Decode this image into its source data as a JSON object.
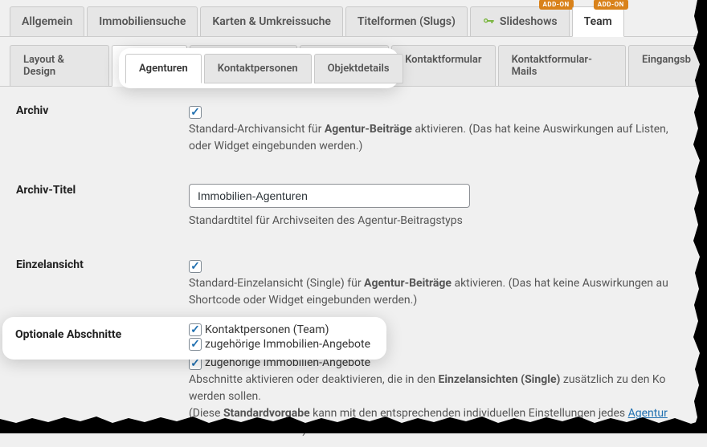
{
  "colors": {
    "accent": "#2271b1",
    "badge": "#d9821b"
  },
  "tabs_top": [
    {
      "label": "Allgemein",
      "active": false
    },
    {
      "label": "Immobiliensuche",
      "active": false
    },
    {
      "label": "Karten & Umkreissuche",
      "active": false
    },
    {
      "label": "Titelformen (Slugs)",
      "active": false
    },
    {
      "label": "Slideshows",
      "active": false,
      "icon": "key-icon",
      "badge": "ADD-ON"
    },
    {
      "label": "Team",
      "active": true,
      "badge": "ADD-ON"
    }
  ],
  "tabs_sub": [
    {
      "label": "Layout & Design",
      "active": false
    },
    {
      "label": "Agenturen",
      "active": true
    },
    {
      "label": "Kontaktpersonen",
      "active": false
    },
    {
      "label": "Objektdetails",
      "active": false
    },
    {
      "label": "Kontaktformular",
      "active": false
    },
    {
      "label": "Kontaktformular-Mails",
      "active": false
    },
    {
      "label": "Eingangsb",
      "active": false
    }
  ],
  "highlight_tabs": [
    {
      "label": "Agenturen",
      "active": true
    },
    {
      "label": "Kontaktpersonen",
      "active": false
    },
    {
      "label": "Objektdetails",
      "active": false
    }
  ],
  "rows": {
    "archiv": {
      "label": "Archiv",
      "checked": true,
      "desc_pre": "Standard-Archivansicht für ",
      "desc_bold": "Agentur-Beiträge",
      "desc_post": " aktivieren. (Das hat keine Auswirkungen auf Listen,",
      "desc_line2": "oder Widget eingebunden werden.)"
    },
    "archiv_titel": {
      "label": "Archiv-Titel",
      "value": "Immobilien-Agenturen",
      "desc": "Standardtitel für Archivseiten des Agentur-Beitragstyps"
    },
    "einzel": {
      "label": "Einzelansicht",
      "checked": true,
      "desc_pre": "Standard-Einzelansicht (Single) für ",
      "desc_bold": "Agentur-Beiträge",
      "desc_post": " aktivieren. (Das hat keine Auswirkungen au",
      "desc_line2": "Shortcode oder Widget eingebunden werden.)"
    },
    "optional": {
      "label": "Optionale Abschnitte",
      "items": [
        {
          "label": "Kontaktpersonen (Team)",
          "checked": true
        },
        {
          "label": "zugehörige Immobilien-Angebote",
          "checked": true
        }
      ],
      "desc_pre": "Abschnitte aktivieren oder deaktivieren, die in den ",
      "desc_bold": "Einzelansichten (Single)",
      "desc_post": " zusätzlich zu den Ko",
      "desc_line2": "werden sollen.",
      "desc_line3_pre": "(Diese ",
      "desc_line3_bold": "Standardvorgabe",
      "desc_line3_mid": " kann mit den entsprechenden individuellen Einstellungen jedes ",
      "desc_line3_link": "Agentur",
      "desc_line4": "überschrieben werden.)"
    }
  }
}
